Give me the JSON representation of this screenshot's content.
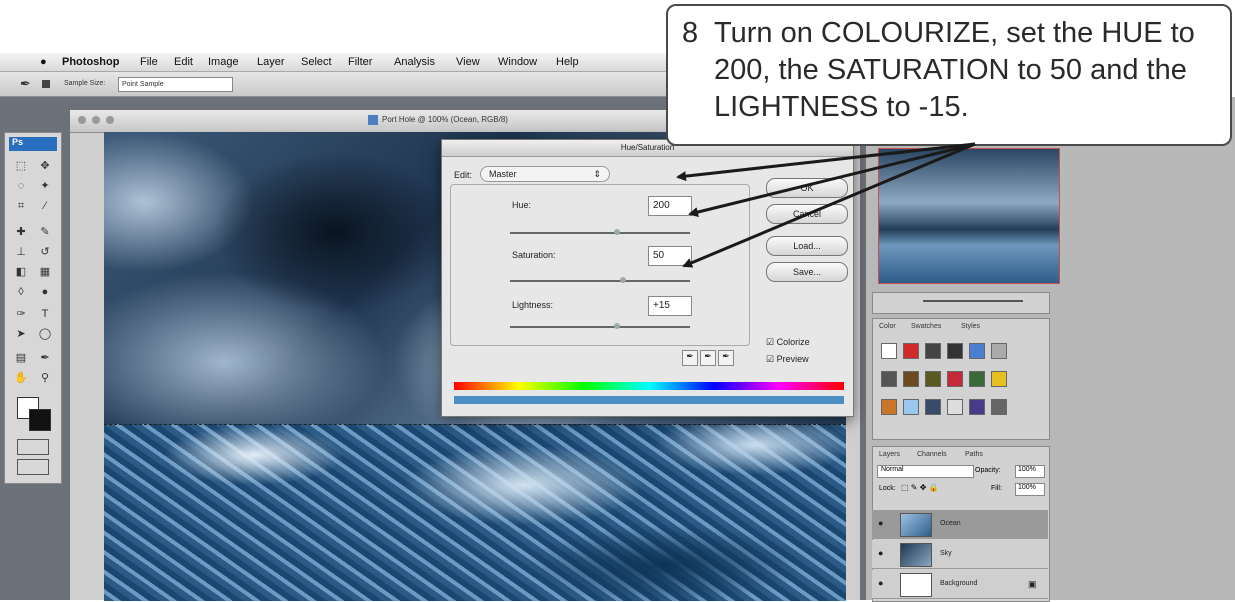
{
  "menubar": {
    "items": [
      "Photoshop",
      "File",
      "Edit",
      "Image",
      "Layer",
      "Select",
      "Filter",
      "Analysis",
      "View",
      "Window",
      "Help"
    ]
  },
  "options_bar": {
    "sample_size_label": "Sample Size:",
    "sample_size_value": "Point Sample"
  },
  "document": {
    "title": "Port Hole @ 100% (Ocean, RGB/8)"
  },
  "toolbox": {
    "badge": "Ps"
  },
  "dialog": {
    "title": "Hue/Saturation",
    "edit_label": "Edit:",
    "edit_value": "Master",
    "hue_label": "Hue:",
    "hue_value": "200",
    "saturation_label": "Saturation:",
    "saturation_value": "50",
    "lightness_label": "Lightness:",
    "lightness_value": "+15",
    "buttons": {
      "ok": "OK",
      "cancel": "Cancel",
      "load": "Load...",
      "save": "Save..."
    },
    "colorize_label": "Colorize",
    "preview_label": "Preview",
    "colorize_checked": true,
    "preview_checked": true
  },
  "panels": {
    "styles_tabs": [
      "Color",
      "Swatches",
      "Styles"
    ],
    "layers_tabs": [
      "Layers",
      "Channels",
      "Paths"
    ],
    "blend_mode": "Normal",
    "opacity_label": "Opacity:",
    "opacity_value": "100%",
    "lock_label": "Lock:",
    "fill_label": "Fill:",
    "fill_value": "100%",
    "layers": [
      "Ocean",
      "Sky",
      "Background"
    ]
  },
  "callout": {
    "number": "8",
    "text": "Turn on COLOURIZE, set the HUE to 200, the SATURATION to 50 and the LIGHTNESS to -15."
  },
  "colors": {
    "callout_border": "#4a4a4a",
    "arrow": "#1a1a1a",
    "navigator_border": "#c45050"
  }
}
